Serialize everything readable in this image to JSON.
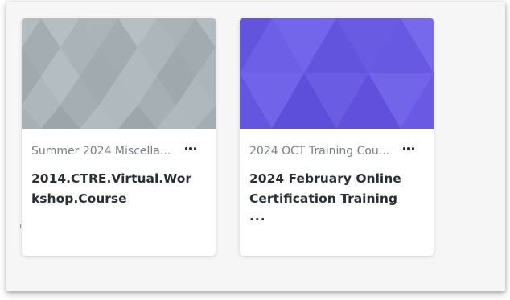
{
  "colors": {
    "text_primary": "#2a2f35",
    "text_secondary": "#7a7f86",
    "card_1_image_bg": "#a7b2b7",
    "card_2_image_bg": "#6d5ee6"
  },
  "cards": [
    {
      "category": "Summer 2024 Miscella...",
      "title": "2014.CTRE.Virtual.Workshop.Course",
      "title_ellipsis": "",
      "menu_icon": "more-horizontal-icon"
    },
    {
      "category": "2024 OCT Training Cou...",
      "title": "2024 February Online Certification Training",
      "title_ellipsis": "...",
      "menu_icon": "more-horizontal-icon"
    }
  ]
}
